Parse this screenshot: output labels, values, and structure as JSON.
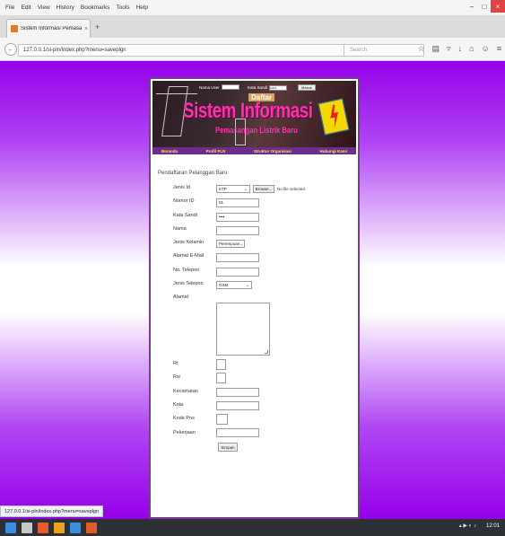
{
  "menubar": {
    "items": [
      "File",
      "Edit",
      "View",
      "History",
      "Bookmarks",
      "Tools",
      "Help"
    ]
  },
  "window": {
    "minimize": "–",
    "maximize": "□",
    "close": "×"
  },
  "tab": {
    "title": "Sistem Informasi Pemasan...",
    "close": "×",
    "new_tab": "+"
  },
  "navbar": {
    "back": "←",
    "url": "127.0.0.1/si-pln/index.php?menu=saveplgn",
    "reload": "▿ C",
    "search_placeholder": "Search",
    "icons": [
      "☆",
      "▤",
      "▿",
      "↓",
      "⌂",
      "☺",
      "≡"
    ]
  },
  "banner": {
    "login_label_user": "Nama User",
    "login_label_pass": "Kata Sandi",
    "login_pass_value": "•••••",
    "login_button": "Masuk",
    "daftar": "Daftar",
    "title": "Sistem Informasi",
    "subtitle": "Pemasangan Listrik Baru",
    "nav": [
      "Beranda",
      "Profil PLN",
      "Struktur Organisasi",
      "Hubungi Kami"
    ],
    "colors": {
      "accent": "#ff2fb0",
      "nav_bg": "#6c2e8c",
      "nav_text": "#ffe060"
    }
  },
  "form": {
    "title": "Pendaftaran Pelanggan Baru",
    "fields": {
      "jenis_id": {
        "label": "Jenis Id",
        "value": "KTP"
      },
      "browse": "Browse...",
      "no_file": "No file selected.",
      "nomor_id": {
        "label": "Nomor ID",
        "value": "01"
      },
      "kata_sandi": {
        "label": "Kata Sandi",
        "value": "••••"
      },
      "nama": {
        "label": "Nama",
        "value": ""
      },
      "jenis_kelamin": {
        "label": "Jenis Kelamin",
        "value": "Perempuan"
      },
      "email": {
        "label": "Alamat E-Mail",
        "value": ""
      },
      "telepon": {
        "label": "No. Telepon",
        "value": ""
      },
      "jenis_telepon": {
        "label": "Jenis Telepon",
        "value": "GSM"
      },
      "alamat": {
        "label": "Alamat",
        "value": ""
      },
      "rt": {
        "label": "Rt",
        "value": ""
      },
      "rw": {
        "label": "Rw",
        "value": ""
      },
      "kecamatan": {
        "label": "Kecamatan",
        "value": ""
      },
      "kota": {
        "label": "Kota",
        "value": ""
      },
      "kode_pos": {
        "label": "Kode Pos",
        "value": ""
      },
      "pekerjaan": {
        "label": "Pekerjaan",
        "value": ""
      }
    },
    "submit": "Simpan"
  },
  "status": {
    "url": "127.0.0.1/si-pln/index.php?menu=saveplgn"
  },
  "taskbar": {
    "tray": "▴ ▶ ◐ ♪",
    "clock": "12:01",
    "icon_colors": [
      "#3a8de0",
      "#c8c8c8",
      "#e85a2a",
      "#f0a020",
      "#3a8de0",
      "#e05a2a"
    ]
  }
}
